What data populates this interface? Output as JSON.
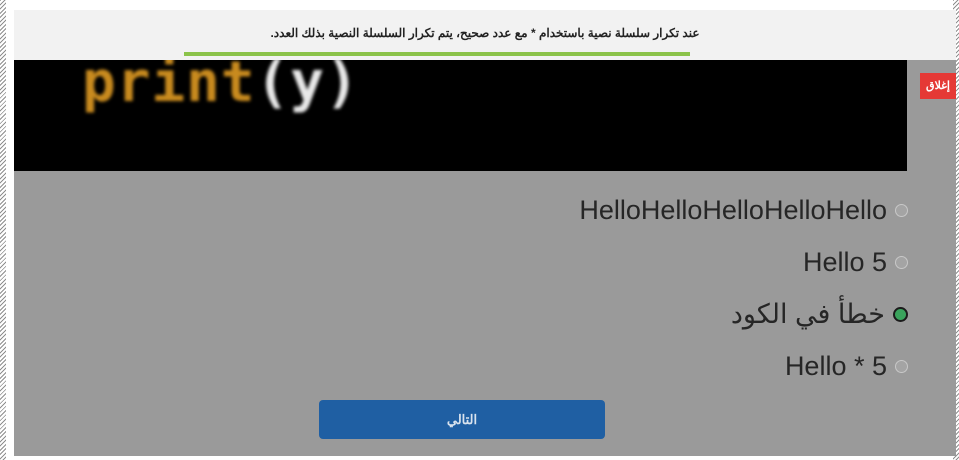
{
  "banner": {
    "text": "عند تكرار سلسلة نصية باستخدام * مع عدد صحيح، يتم تكرار السلسلة النصية بذلك العدد."
  },
  "code": {
    "function": "print",
    "open_paren": "(",
    "argument": "y",
    "close_paren": ")"
  },
  "close_button": {
    "label": "إغلاق"
  },
  "options": [
    {
      "label": "HelloHelloHelloHelloHello",
      "selected": false
    },
    {
      "label": "Hello 5",
      "selected": false
    },
    {
      "label": "خطأ في الكود",
      "selected": true
    },
    {
      "label": "Hello * 5",
      "selected": false
    }
  ],
  "next_button": {
    "label": "التالي"
  },
  "colors": {
    "accent_underline": "#8bc34a",
    "close_button": "#e53935",
    "next_button": "#1f5fa3",
    "selected_radio": "#3aa35c",
    "overlay_gray": "#9a9a9a"
  }
}
